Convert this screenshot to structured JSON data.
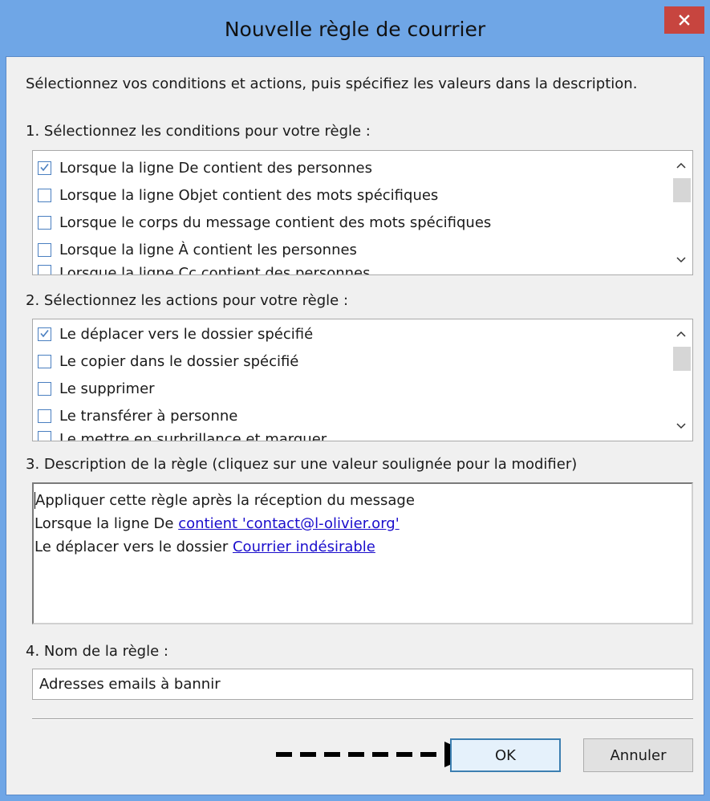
{
  "window": {
    "title": "Nouvelle règle de courrier"
  },
  "intro": "Sélectionnez vos conditions et actions, puis spécifiez les valeurs dans la description.",
  "conditions": {
    "label": "1. Sélectionnez les conditions pour votre règle :",
    "items": [
      {
        "label": "Lorsque la ligne De contient des personnes",
        "checked": true
      },
      {
        "label": "Lorsque la ligne Objet contient des mots spécifiques",
        "checked": false
      },
      {
        "label": "Lorsque le corps du message contient des mots spécifiques",
        "checked": false
      },
      {
        "label": "Lorsque la ligne À contient les personnes",
        "checked": false
      },
      {
        "label": "Lorsque la ligne Cc contient des personnes",
        "checked": false
      }
    ]
  },
  "actions": {
    "label": "2. Sélectionnez les actions pour votre règle :",
    "items": [
      {
        "label": "Le déplacer vers le dossier spécifié",
        "checked": true
      },
      {
        "label": "Le copier dans le dossier spécifié",
        "checked": false
      },
      {
        "label": "Le supprimer",
        "checked": false
      },
      {
        "label": "Le transférer à personne",
        "checked": false
      },
      {
        "label": "Le mettre en surbrillance et marquer",
        "checked": false
      }
    ]
  },
  "description": {
    "label": "3. Description de la règle (cliquez sur une valeur soulignée pour la modifier)",
    "line1": "Appliquer cette règle après la réception du message",
    "line2_prefix": "Lorsque la ligne De ",
    "line2_link": "contient 'contact@l-olivier.org'",
    "line3_prefix": "Le déplacer vers le dossier ",
    "line3_link": "Courrier indésirable"
  },
  "name": {
    "label": "4. Nom de la règle :",
    "value": "Adresses emails à bannir"
  },
  "buttons": {
    "ok": "OK",
    "cancel": "Annuler"
  },
  "icons": {
    "close": "close-icon",
    "checkbox_checked": "checkmark-icon",
    "scroll_up": "chevron-up-icon",
    "scroll_down": "chevron-down-icon",
    "annotation": "dashed-arrow-icon"
  },
  "colors": {
    "titlebar": "#6fa6e6",
    "close": "#c7453f",
    "link": "#1a0dcc",
    "checkbox_border": "#4a7fc0"
  }
}
